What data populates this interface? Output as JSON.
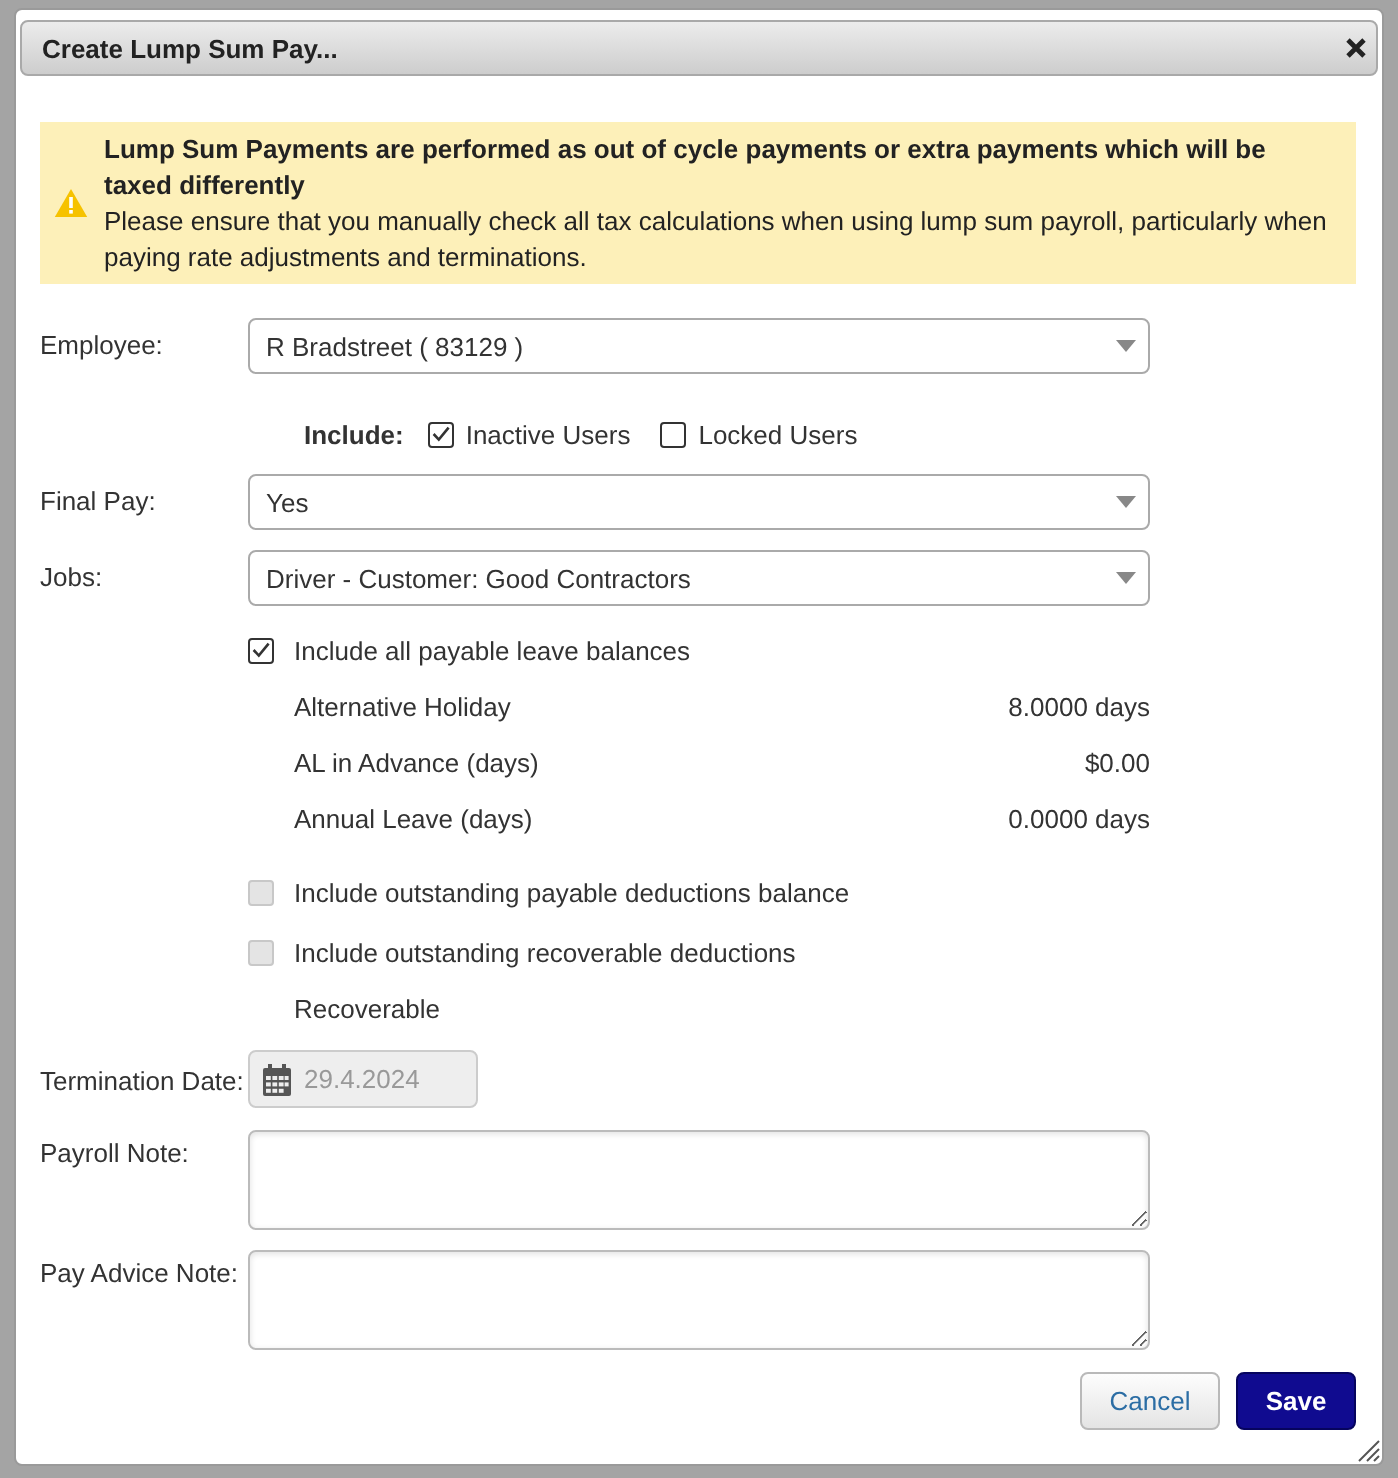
{
  "window": {
    "title": "Create Lump Sum Pay..."
  },
  "warning": {
    "heading": "Lump Sum Payments are performed as out of cycle payments or extra payments which will be taxed differently",
    "body": "Please ensure that you manually check all tax calculations when using lump sum payroll, particularly when paying rate adjustments and terminations."
  },
  "employee": {
    "label": "Employee:",
    "value": "R Bradstreet ( 83129 )"
  },
  "include": {
    "label": "Include:",
    "options": [
      {
        "label": "Inactive Users",
        "checked": true
      },
      {
        "label": "Locked Users",
        "checked": false
      }
    ]
  },
  "final_pay": {
    "label": "Final Pay:",
    "value": "Yes"
  },
  "jobs": {
    "label": "Jobs:",
    "value": "Driver - Customer: Good Contractors"
  },
  "payout_options": [
    {
      "label": "Include all payable leave balances",
      "checked": true,
      "disabled": false,
      "balances": [
        {
          "name": "Alternative Holiday",
          "amount": "8.0000 days"
        },
        {
          "name": "AL in Advance (days)",
          "amount": "$0.00"
        },
        {
          "name": "Annual Leave (days)",
          "amount": "0.0000 days"
        }
      ]
    },
    {
      "label": "Include outstanding payable deductions balance",
      "checked": false,
      "disabled": true
    },
    {
      "label": "Include outstanding recoverable deductions",
      "checked": false,
      "disabled": true,
      "note": "Recoverable"
    }
  ],
  "termination_date": {
    "label": "Termination Date:",
    "value": "29.4.2024",
    "disabled": true
  },
  "payroll_note": {
    "label": "Payroll Note:"
  },
  "pay_advice_note": {
    "label": "Pay Advice Note:"
  },
  "buttons": [
    {
      "label": "Cancel",
      "kind": "secondary"
    },
    {
      "label": "Save",
      "kind": "primary"
    }
  ]
}
